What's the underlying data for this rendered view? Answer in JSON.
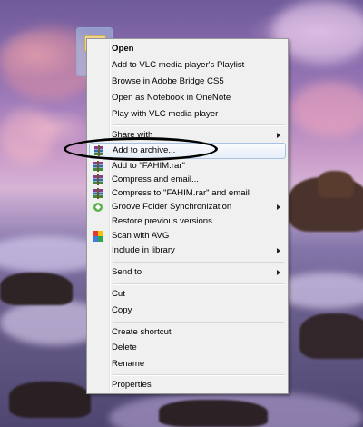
{
  "menu": {
    "items": [
      {
        "label": "Open",
        "bold": true
      },
      {
        "label": "Add to VLC media player's Playlist"
      },
      {
        "label": "Browse in Adobe Bridge CS5"
      },
      {
        "label": "Open as Notebook in OneNote"
      },
      {
        "label": "Play with VLC media player"
      },
      {
        "label": "Share with",
        "submenu": true
      },
      {
        "label": "Add to archive...",
        "highlighted": true,
        "icon": "winrar-icon"
      },
      {
        "label": "Add to \"FAHIM.rar\"",
        "icon": "winrar-icon"
      },
      {
        "label": "Compress and email...",
        "icon": "winrar-icon"
      },
      {
        "label": "Compress to \"FAHIM.rar\" and email",
        "icon": "winrar-icon"
      },
      {
        "label": "Groove Folder Synchronization",
        "submenu": true,
        "icon": "groove-icon"
      },
      {
        "label": "Restore previous versions"
      },
      {
        "label": "Scan with AVG",
        "icon": "avg-icon"
      },
      {
        "label": "Include in library",
        "submenu": true
      },
      {
        "label": "Send to",
        "submenu": true
      },
      {
        "label": "Cut"
      },
      {
        "label": "Copy"
      },
      {
        "label": "Create shortcut"
      },
      {
        "label": "Delete"
      },
      {
        "label": "Rename"
      },
      {
        "label": "Properties"
      }
    ]
  },
  "colors": {
    "menu_bg": "#f0f0f0",
    "highlight_border": "#a8c2e6",
    "annotation": "#000000"
  }
}
